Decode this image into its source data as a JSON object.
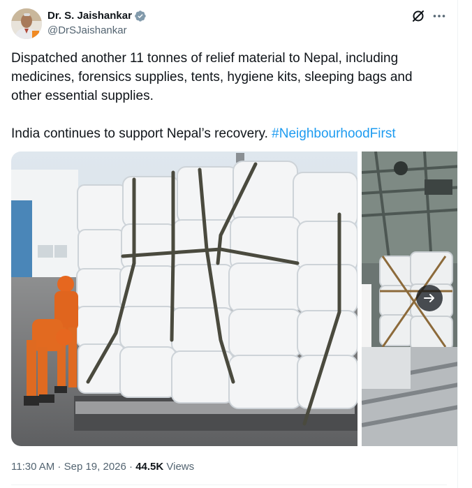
{
  "author": {
    "display_name": "Dr. S. Jaishankar",
    "handle": "@DrSJaishankar",
    "verified": true,
    "verified_color": "#829aab"
  },
  "actions": {
    "grok_icon": "grok-icon",
    "more_icon": "more-horizontal-icon"
  },
  "tweet": {
    "line1": "Dispatched another 11 tonnes of relief material to Nepal, including",
    "line2": "medicines, forensics supplies, tents, hygiene kits, sleeping bags and",
    "line3": "other essential supplies.",
    "line4_text": "India continues to support Nepal’s recovery. ",
    "hashtag": "#NeighbourhoodFirst",
    "hashtag_color": "#1d9bf0"
  },
  "media": {
    "count": 2,
    "next_icon": "arrow-right-icon"
  },
  "meta": {
    "time": "11:30 AM",
    "separator": " · ",
    "date": "Sep 19, 2026",
    "separator2": " · ",
    "views_count": "44.5K",
    "views_label": " Views"
  },
  "colors": {
    "text": "#0f1419",
    "secondary": "#536471",
    "divider": "#eff3f4"
  }
}
